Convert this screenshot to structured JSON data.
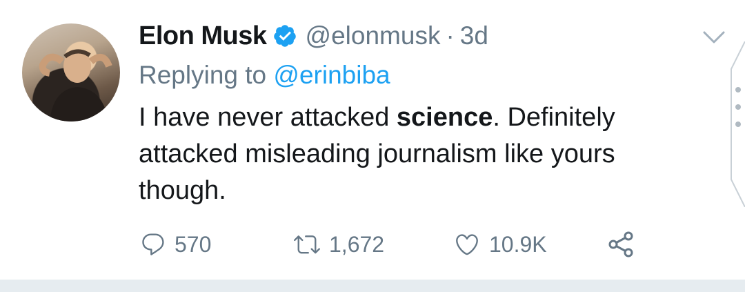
{
  "tweet": {
    "author_name": "Elon Musk",
    "handle": "@elonmusk",
    "separator": "·",
    "time": "3d",
    "replying_prefix": "Replying to ",
    "replying_to": "@erinbiba",
    "text_before": "I have never attacked ",
    "text_bold": "science",
    "text_after": ". Definitely attacked misleading journalism like yours though."
  },
  "actions": {
    "replies": "570",
    "retweets": "1,672",
    "likes": "10.9K"
  },
  "colors": {
    "primary_text": "#14171a",
    "secondary_text": "#657786",
    "accent": "#1da1f2",
    "divider": "#e6ecf0"
  },
  "icons": {
    "verified": "verified-badge-icon",
    "menu": "chevron-down-icon",
    "reply": "reply-icon",
    "retweet": "retweet-icon",
    "like": "heart-icon",
    "share": "share-icon"
  }
}
